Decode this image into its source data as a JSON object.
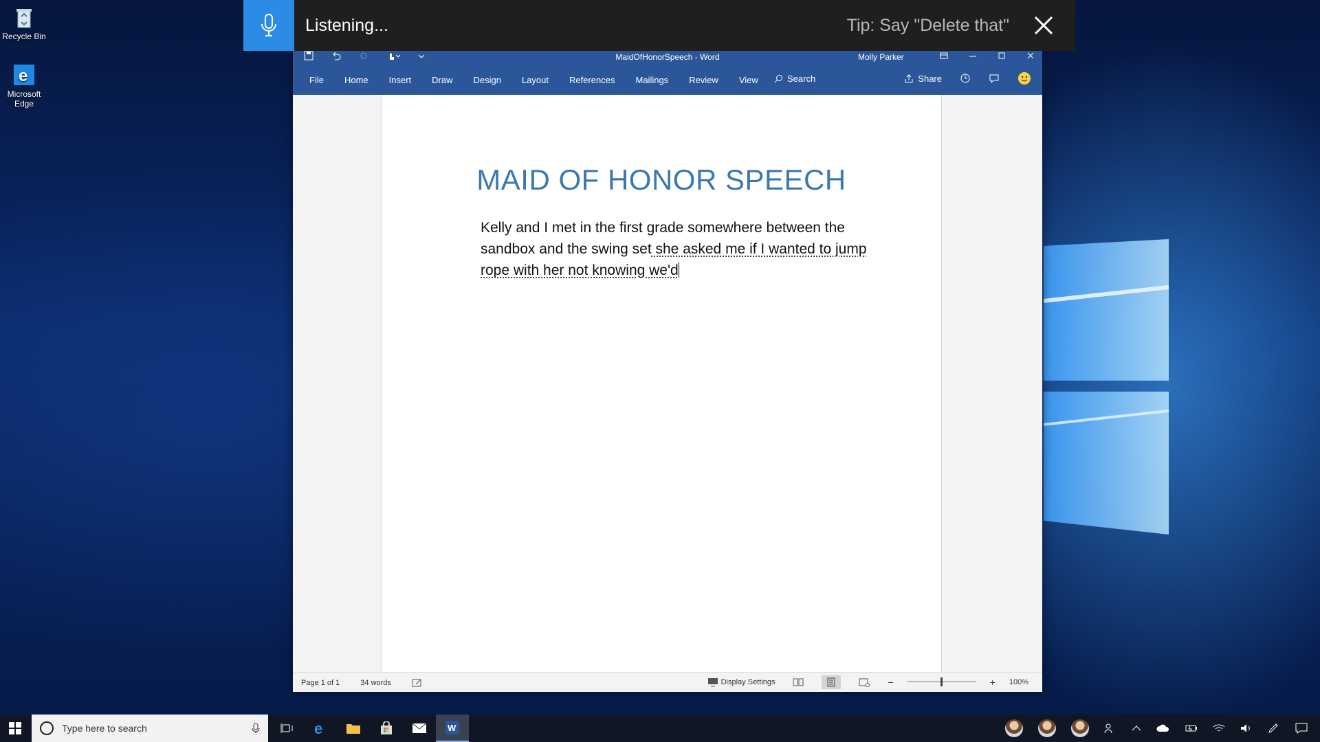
{
  "desktop": {
    "icons": [
      {
        "label": "Recycle Bin"
      },
      {
        "label": "Microsoft Edge"
      }
    ]
  },
  "dictation": {
    "status": "Listening...",
    "tip": "Tip: Say \"Delete that\""
  },
  "word": {
    "window_title": "MaidOfHonorSpeech  -  Word",
    "user_name": "Molly Parker",
    "tabs": [
      "File",
      "Home",
      "Insert",
      "Draw",
      "Design",
      "Layout",
      "References",
      "Mailings",
      "Review",
      "View"
    ],
    "search_label": "Search",
    "share_label": "Share",
    "document": {
      "title": "MAID OF HONOR SPEECH",
      "body_confirmed": "Kelly and I met in the first grade somewhere between the sandbox and the swing set",
      "body_pending": " she asked me if I wanted to jump rope with her not knowing we'd"
    },
    "status": {
      "page": "Page 1 of 1",
      "words": "34 words",
      "display_settings": "Display Settings",
      "zoom": "100%",
      "zoom_level": 1.0
    }
  },
  "taskbar": {
    "search_placeholder": "Type here to search"
  },
  "colors": {
    "word_blue": "#2b579a",
    "dictation_blue": "#2b8ce6",
    "title_blue": "#3a78b0"
  }
}
